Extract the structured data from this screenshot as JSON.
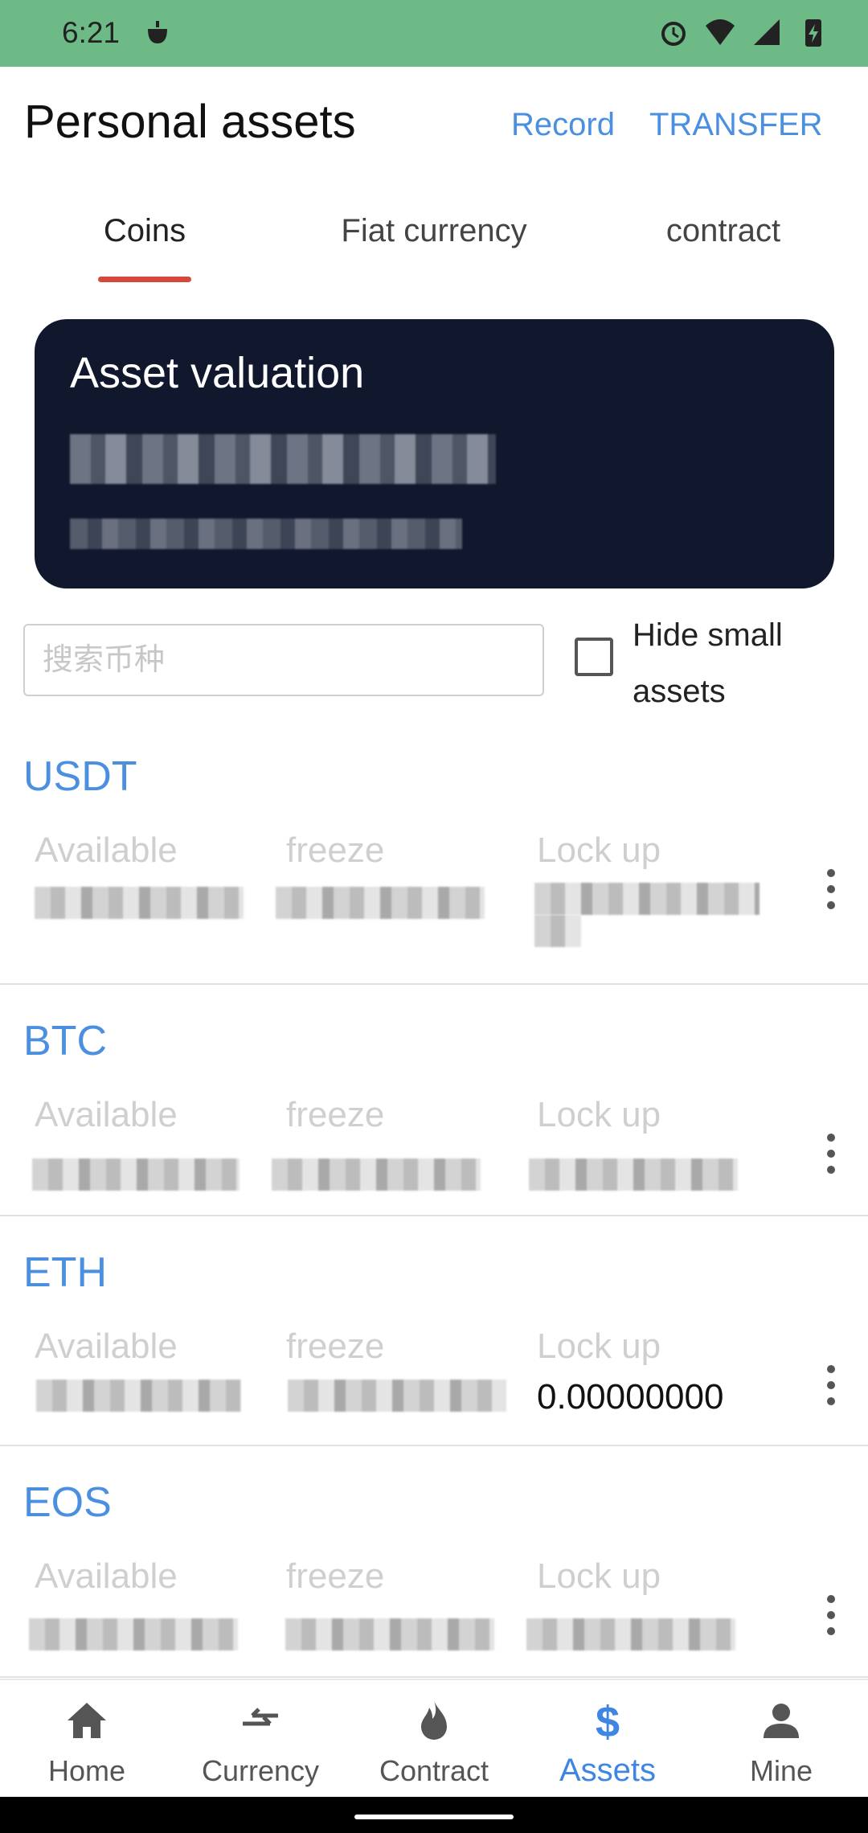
{
  "status_bar": {
    "time": "6:21",
    "left_icon": "notification-app-icon",
    "right_icons": [
      "alarm-icon",
      "wifi-icon",
      "signal-icon",
      "battery-charging-icon"
    ],
    "color": "#6dba87"
  },
  "header": {
    "title": "Personal assets",
    "record_label": "Record",
    "transfer_label": "TRANSFER",
    "link_color": "#4a8fe0"
  },
  "tabs": [
    {
      "label": "Coins",
      "active": true
    },
    {
      "label": "Fiat currency",
      "active": false
    },
    {
      "label": "contract",
      "active": false
    }
  ],
  "valuation": {
    "title": "Asset valuation",
    "card_color": "#11182d"
  },
  "search": {
    "placeholder": "搜索币种",
    "value": ""
  },
  "hide_small": {
    "label": "Hide small assets",
    "checked": false
  },
  "assets": [
    {
      "name": "USDT",
      "available_label": "Available",
      "freeze_label": "freeze",
      "lockup_label": "Lock up",
      "lockup_value": ""
    },
    {
      "name": "BTC",
      "available_label": "Available",
      "freeze_label": "freeze",
      "lockup_label": "Lock up",
      "lockup_value": ""
    },
    {
      "name": "ETH",
      "available_label": "Available",
      "freeze_label": "freeze",
      "lockup_label": "Lock up",
      "lockup_value": "0.00000000"
    },
    {
      "name": "EOS",
      "available_label": "Available",
      "freeze_label": "freeze",
      "lockup_label": "Lock up",
      "lockup_value": ""
    }
  ],
  "bottom_nav": [
    {
      "label": "Home",
      "icon": "home-icon",
      "active": false
    },
    {
      "label": "Currency",
      "icon": "exchange-arrows-icon",
      "active": false
    },
    {
      "label": "Contract",
      "icon": "flame-icon",
      "active": false
    },
    {
      "label": "Assets",
      "icon": "dollar-icon",
      "active": true
    },
    {
      "label": "Mine",
      "icon": "person-icon",
      "active": false
    }
  ],
  "accent_color": "#3f86e4",
  "tab_indicator_color": "#d6483b"
}
